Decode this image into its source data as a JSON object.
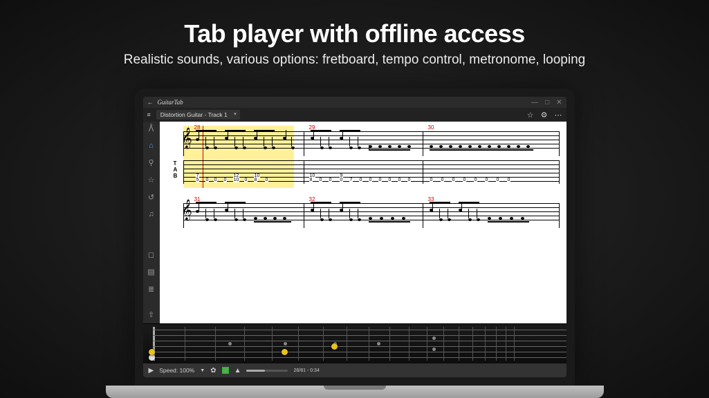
{
  "hero": {
    "title": "Tab player with offline access",
    "subtitle": "Realistic sounds, various options: fretboard, tempo control, metronome, looping"
  },
  "app": {
    "name": "GuitarTab",
    "track_selector": "Distortion Guitar - Track 1"
  },
  "score": {
    "system1": {
      "measures": [
        "28",
        "29",
        "30"
      ],
      "tab_row_a": [
        "7",
        "12",
        "10",
        "10",
        "9"
      ],
      "tab_row_b": [
        "5",
        "0",
        "0",
        "0",
        "10",
        "0",
        "8",
        "0",
        "8",
        "0",
        "0",
        "0",
        "7",
        "0",
        "0",
        "0",
        "0",
        "0",
        "0",
        "0",
        "0",
        "0",
        "0",
        "0",
        "0",
        "0",
        "0"
      ]
    },
    "system2": {
      "measures": [
        "31",
        "32",
        "33"
      ]
    }
  },
  "transport": {
    "speed_label": "Speed: 100%",
    "position": "28/81 - 0:34"
  }
}
